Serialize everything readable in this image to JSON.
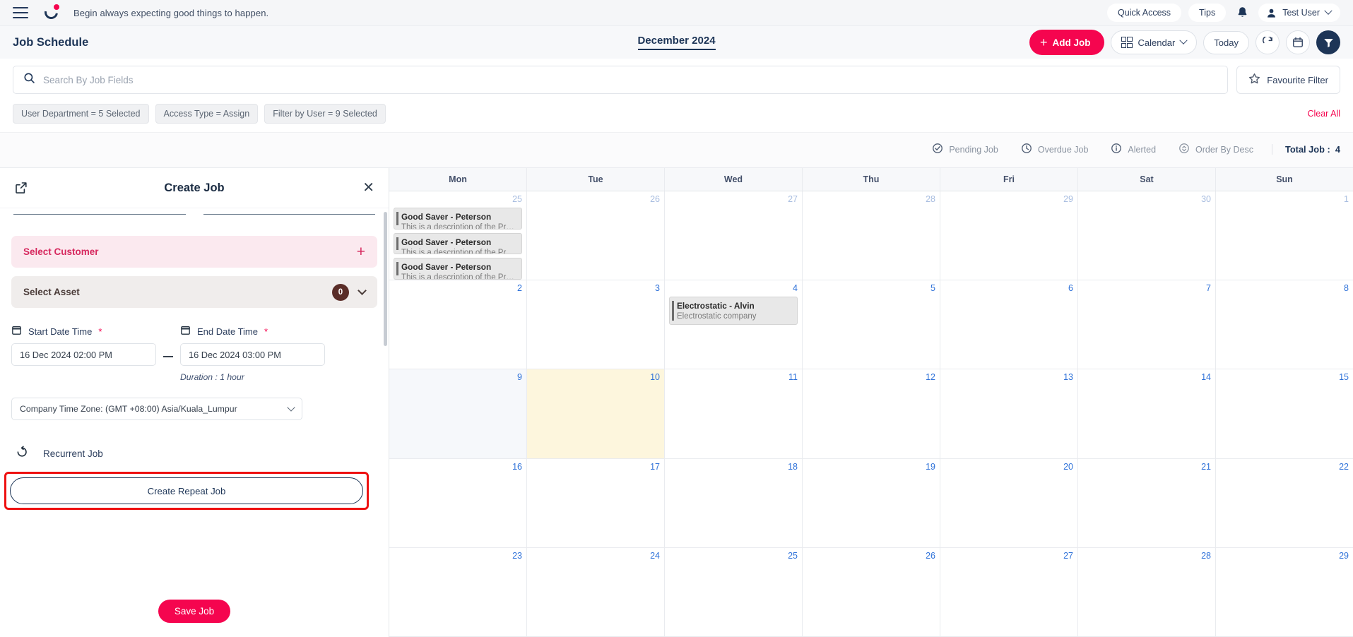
{
  "topbar": {
    "tagline": "Begin always expecting good things to happen.",
    "quick_access": "Quick Access",
    "tips": "Tips",
    "user_name": "Test User"
  },
  "header": {
    "page_title": "Job Schedule",
    "month_label": "December 2024",
    "add_job": "Add Job",
    "view_mode": "Calendar",
    "today": "Today"
  },
  "search": {
    "placeholder": "Search By Job Fields",
    "value": "",
    "favourite_filter": "Favourite Filter"
  },
  "filters": {
    "chips": [
      "User Department  =  5 Selected",
      "Access Type  =  Assign",
      "Filter by User  =  9 Selected"
    ],
    "clear_all": "Clear All"
  },
  "status_bar": {
    "items": [
      {
        "label": "Pending Job",
        "icon": "check-circle-icon"
      },
      {
        "label": "Overdue Job",
        "icon": "clock-icon"
      },
      {
        "label": "Alerted",
        "icon": "info-circle-icon"
      },
      {
        "label": "Order By Desc",
        "icon": "sort-icon"
      }
    ],
    "total_label": "Total Job :",
    "total_value": "4"
  },
  "panel": {
    "title": "Create Job",
    "select_customer": "Select Customer",
    "select_asset": "Select Asset",
    "asset_count": "0",
    "start_label": "Start Date Time",
    "start_value": "16 Dec 2024 02:00 PM",
    "end_label": "End Date Time",
    "end_value": "16 Dec 2024 03:00 PM",
    "duration": "Duration : 1 hour",
    "timezone": "Company Time Zone: (GMT +08:00) Asia/Kuala_Lumpur",
    "recurrent_job": "Recurrent Job",
    "create_repeat_job": "Create Repeat Job",
    "save_job": "Save Job"
  },
  "calendar": {
    "day_headers": [
      "Mon",
      "Tue",
      "Wed",
      "Thu",
      "Fri",
      "Sat",
      "Sun"
    ],
    "weeks": [
      {
        "days": [
          {
            "num": "25",
            "dim": true,
            "today": false,
            "shade": false,
            "events": [
              {
                "title": "Good Saver - Peterson",
                "desc": "This is a description of the Pro..."
              },
              {
                "title": "Good Saver - Peterson",
                "desc": "This is a description of the Pro..."
              },
              {
                "title": "Good Saver - Peterson",
                "desc": "This is a description of the Pro..."
              }
            ]
          },
          {
            "num": "26",
            "dim": true,
            "today": false,
            "shade": false,
            "events": []
          },
          {
            "num": "27",
            "dim": true,
            "today": false,
            "shade": false,
            "events": []
          },
          {
            "num": "28",
            "dim": true,
            "today": false,
            "shade": false,
            "events": []
          },
          {
            "num": "29",
            "dim": true,
            "today": false,
            "shade": false,
            "events": []
          },
          {
            "num": "30",
            "dim": true,
            "today": false,
            "shade": false,
            "events": []
          },
          {
            "num": "1",
            "dim": true,
            "today": false,
            "shade": false,
            "events": []
          }
        ]
      },
      {
        "days": [
          {
            "num": "2",
            "dim": false,
            "today": false,
            "shade": false,
            "events": []
          },
          {
            "num": "3",
            "dim": false,
            "today": false,
            "shade": false,
            "events": []
          },
          {
            "num": "4",
            "dim": false,
            "today": false,
            "shade": false,
            "events": [
              {
                "title": "Electrostatic - Alvin",
                "desc": "Electrostatic company"
              }
            ]
          },
          {
            "num": "5",
            "dim": false,
            "today": false,
            "shade": false,
            "events": []
          },
          {
            "num": "6",
            "dim": false,
            "today": false,
            "shade": false,
            "events": []
          },
          {
            "num": "7",
            "dim": false,
            "today": false,
            "shade": false,
            "events": []
          },
          {
            "num": "8",
            "dim": false,
            "today": false,
            "shade": false,
            "events": []
          }
        ]
      },
      {
        "days": [
          {
            "num": "9",
            "dim": false,
            "today": false,
            "shade": true,
            "events": []
          },
          {
            "num": "10",
            "dim": false,
            "today": true,
            "shade": false,
            "events": []
          },
          {
            "num": "11",
            "dim": false,
            "today": false,
            "shade": false,
            "events": []
          },
          {
            "num": "12",
            "dim": false,
            "today": false,
            "shade": false,
            "events": []
          },
          {
            "num": "13",
            "dim": false,
            "today": false,
            "shade": false,
            "events": []
          },
          {
            "num": "14",
            "dim": false,
            "today": false,
            "shade": false,
            "events": []
          },
          {
            "num": "15",
            "dim": false,
            "today": false,
            "shade": false,
            "events": []
          }
        ]
      },
      {
        "days": [
          {
            "num": "16",
            "dim": false,
            "today": false,
            "shade": false,
            "events": []
          },
          {
            "num": "17",
            "dim": false,
            "today": false,
            "shade": false,
            "events": []
          },
          {
            "num": "18",
            "dim": false,
            "today": false,
            "shade": false,
            "events": []
          },
          {
            "num": "19",
            "dim": false,
            "today": false,
            "shade": false,
            "events": []
          },
          {
            "num": "20",
            "dim": false,
            "today": false,
            "shade": false,
            "events": []
          },
          {
            "num": "21",
            "dim": false,
            "today": false,
            "shade": false,
            "events": []
          },
          {
            "num": "22",
            "dim": false,
            "today": false,
            "shade": false,
            "events": []
          }
        ]
      },
      {
        "days": [
          {
            "num": "23",
            "dim": false,
            "today": false,
            "shade": false,
            "events": []
          },
          {
            "num": "24",
            "dim": false,
            "today": false,
            "shade": false,
            "events": []
          },
          {
            "num": "25",
            "dim": false,
            "today": false,
            "shade": false,
            "events": []
          },
          {
            "num": "26",
            "dim": false,
            "today": false,
            "shade": false,
            "events": []
          },
          {
            "num": "27",
            "dim": false,
            "today": false,
            "shade": false,
            "events": []
          },
          {
            "num": "28",
            "dim": false,
            "today": false,
            "shade": false,
            "events": []
          },
          {
            "num": "29",
            "dim": false,
            "today": false,
            "shade": false,
            "events": []
          }
        ]
      }
    ]
  },
  "colors": {
    "accent_pink": "#f5054f",
    "navy": "#1d3557",
    "today_bg": "#fdf6dd",
    "highlight_red": "#ee1111"
  }
}
